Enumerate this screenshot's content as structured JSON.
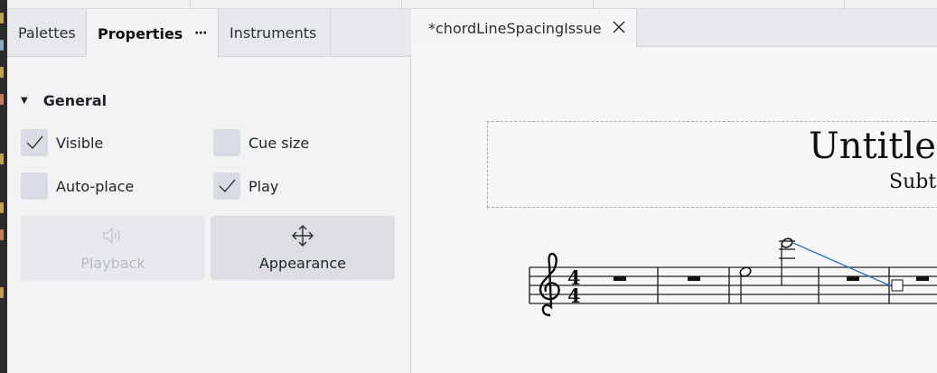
{
  "left_panel": {
    "tabs": [
      {
        "label": "Palettes"
      },
      {
        "label": "Properties",
        "menu": "⋯"
      },
      {
        "label": "Instruments"
      }
    ],
    "section": {
      "title": "General",
      "expanded": true
    },
    "checkboxes": {
      "visible": {
        "label": "Visible",
        "checked": true
      },
      "cue_size": {
        "label": "Cue size",
        "checked": false
      },
      "auto_place": {
        "label": "Auto-place",
        "checked": false
      },
      "play": {
        "label": "Play",
        "checked": true
      }
    },
    "buttons": {
      "playback": {
        "label": "Playback",
        "icon": "speaker-icon",
        "enabled": false
      },
      "appearance": {
        "label": "Appearance",
        "icon": "move-arrows-icon",
        "enabled": true
      }
    }
  },
  "document": {
    "tab_label": "*chordLineSpacingIssue",
    "score_title": "Untitle",
    "score_subtitle": "Subt",
    "time_signature": {
      "top": "4",
      "bottom": "4"
    }
  },
  "colors": {
    "accent_line": "#2b74c7",
    "checkbox_bg": "#d9dce2"
  }
}
